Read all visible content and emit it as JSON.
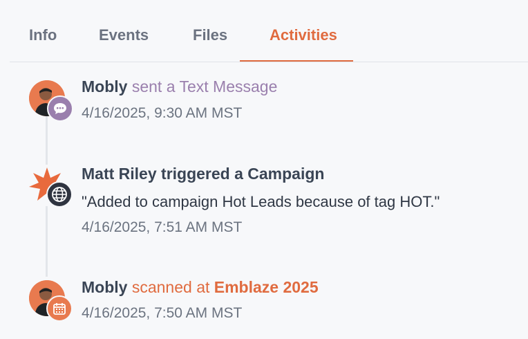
{
  "tabs": [
    {
      "label": "Info"
    },
    {
      "label": "Events"
    },
    {
      "label": "Files"
    },
    {
      "label": "Activities",
      "active": true
    }
  ],
  "colors": {
    "accent": "#e06b3f",
    "message_purple": "#9a7fad",
    "text_dark": "#3a4555",
    "muted": "#6b7380"
  },
  "activities": [
    {
      "actor": "Mobly",
      "verb": "sent a Text Message",
      "time": "4/16/2025, 9:30 AM MST",
      "avatar_icon": "person-avatar",
      "badge_icon": "chat-bubble-icon"
    },
    {
      "actor": "Matt Riley",
      "verb": "triggered a Campaign",
      "detail": "\"Added to campaign Hot Leads because of tag HOT.\"",
      "time": "4/16/2025, 7:51 AM MST",
      "avatar_icon": "starburst-logo",
      "badge_icon": "globe-icon"
    },
    {
      "actor": "Mobly",
      "verb": "scanned at",
      "target": "Emblaze 2025",
      "time": "4/16/2025, 7:50 AM MST",
      "avatar_icon": "person-avatar",
      "badge_icon": "calendar-icon"
    }
  ]
}
